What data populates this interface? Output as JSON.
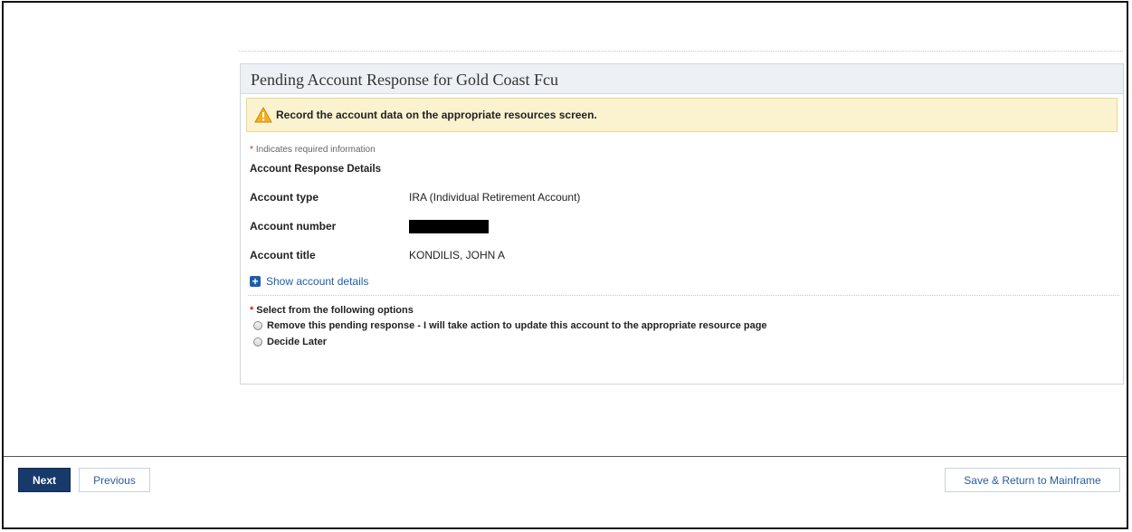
{
  "panel": {
    "title": "Pending Account Response for Gold Coast Fcu",
    "alert_text": "Record the account data on the appropriate resources screen.",
    "required_star": "*",
    "required_note": "Indicates required information",
    "section_title": "Account Response Details",
    "fields": [
      {
        "label": "Account type",
        "value": "IRA (Individual Retirement Account)"
      },
      {
        "label": "Account number",
        "value": ""
      },
      {
        "label": "Account title",
        "value": "KONDILIS, JOHN A"
      }
    ],
    "show_details_label": "Show account details",
    "options_title": "Select from the following options",
    "options": [
      {
        "label": "Remove this pending response - I will take action to update this account to the appropriate resource page"
      },
      {
        "label": "Decide Later"
      }
    ]
  },
  "footer": {
    "next_label": "Next",
    "previous_label": "Previous",
    "save_return_label": "Save & Return to Mainframe"
  },
  "colors": {
    "primary_button": "#173a6b",
    "link": "#1d5fa8",
    "alert_bg": "#fbf3cf"
  }
}
